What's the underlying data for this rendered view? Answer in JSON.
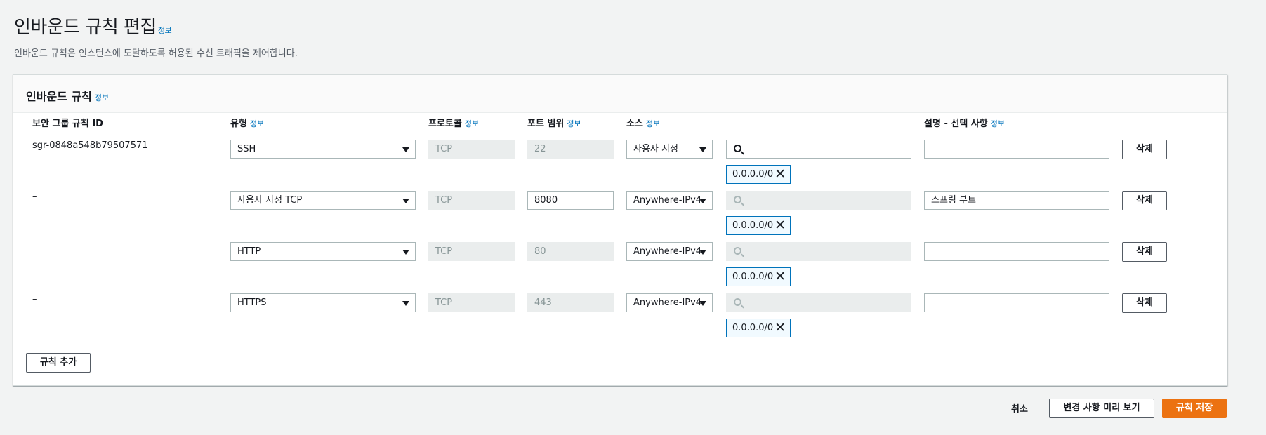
{
  "page": {
    "title": "인바운드 규칙 편집",
    "title_info": "정보",
    "description": "인바운드 규칙은 인스턴스에 도달하도록 허용된 수신 트래픽을 제어합니다."
  },
  "panel": {
    "title": "인바운드 규칙",
    "title_info": "정보"
  },
  "columns": {
    "rule_id": "보안 그룹 규칙 ID",
    "type": "유형",
    "protocol": "프로토콜",
    "port_range": "포트 범위",
    "source": "소스",
    "description": "설명 - 선택 사항",
    "info": "정보"
  },
  "rows": [
    {
      "rule_id": "sgr-0848a548b79507571",
      "type": "SSH",
      "protocol": "TCP",
      "port": "22",
      "source": "사용자 지정",
      "search": "",
      "cidr": "0.0.0.0/0",
      "description": "",
      "delete_label": "삭제"
    },
    {
      "rule_id": "–",
      "type": "사용자 지정 TCP",
      "protocol": "TCP",
      "port": "8080",
      "source": "Anywhere-IPv4",
      "search": "",
      "cidr": "0.0.0.0/0",
      "description": "스프링 부트",
      "delete_label": "삭제"
    },
    {
      "rule_id": "–",
      "type": "HTTP",
      "protocol": "TCP",
      "port": "80",
      "source": "Anywhere-IPv4",
      "search": "",
      "cidr": "0.0.0.0/0",
      "description": "",
      "delete_label": "삭제"
    },
    {
      "rule_id": "–",
      "type": "HTTPS",
      "protocol": "TCP",
      "port": "443",
      "source": "Anywhere-IPv4",
      "search": "",
      "cidr": "0.0.0.0/0",
      "description": "",
      "delete_label": "삭제"
    }
  ],
  "add_rule_label": "규칙 추가",
  "footer": {
    "cancel_label": "취소",
    "preview_label": "변경 사항 미리 보기",
    "save_label": "규칙 저장"
  },
  "colors": {
    "accent": "#0073bb",
    "primary_button": "#ec7211",
    "token_bg": "#f1faff"
  }
}
